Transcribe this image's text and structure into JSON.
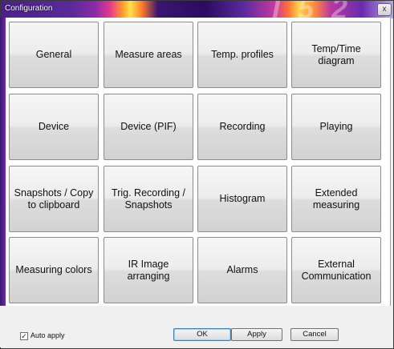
{
  "window": {
    "title": "Configuration",
    "close_glyph": "x",
    "watermark": "I 5 2"
  },
  "tiles": [
    {
      "label": "General"
    },
    {
      "label": "Measure areas"
    },
    {
      "label": "Temp. profiles"
    },
    {
      "label": "Temp/Time\ndiagram"
    },
    {
      "label": "Device"
    },
    {
      "label": "Device (PIF)"
    },
    {
      "label": "Recording"
    },
    {
      "label": "Playing"
    },
    {
      "label": "Snapshots / Copy\nto clipboard"
    },
    {
      "label": "Trig. Recording /\nSnapshots"
    },
    {
      "label": "Histogram"
    },
    {
      "label": "Extended\nmeasuring"
    },
    {
      "label": "Measuring colors"
    },
    {
      "label": "IR Image\narranging"
    },
    {
      "label": "Alarms"
    },
    {
      "label": "External\nCommunication"
    }
  ],
  "footer": {
    "auto_apply_label": "Auto apply",
    "auto_apply_checked": true,
    "check_glyph": "✓",
    "ok_label": "OK",
    "apply_label": "Apply",
    "cancel_label": "Cancel"
  }
}
